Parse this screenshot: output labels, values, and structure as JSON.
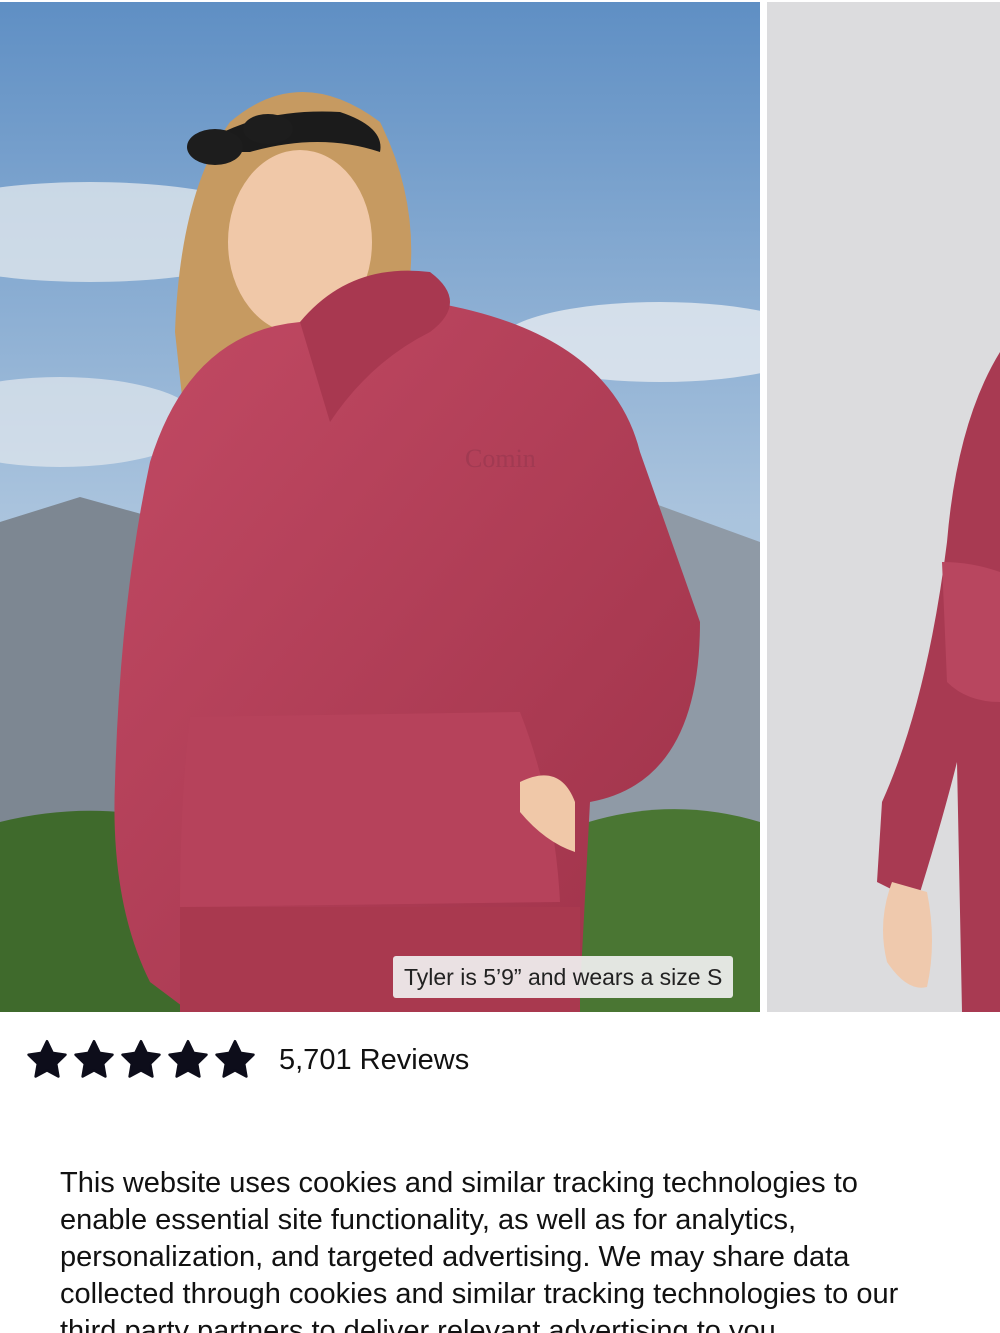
{
  "gallery": {
    "images": [
      {
        "icon": "product-photo-model-in-hoodie",
        "embossed_logo": "Comin"
      },
      {
        "icon": "product-photo-studio-side-view"
      }
    ],
    "caption": "Tyler is 5’9” and wears a size S"
  },
  "reviews": {
    "rating": 5,
    "max_rating": 5,
    "star_icon": "star-icon",
    "count_label": "5,701 Reviews"
  },
  "cookie_banner": {
    "text": "This website uses cookies and similar tracking technologies to enable essential site functionality, as well as for analytics, personalization, and targeted advertising. We may share data collected through cookies and similar tracking technologies to our third party partners to deliver relevant advertising to you."
  },
  "colors": {
    "hoodie": "#b03d55",
    "sky": "#8fb3d9",
    "studio_bg": "#dcdcde",
    "star": "#0d0d1a"
  }
}
